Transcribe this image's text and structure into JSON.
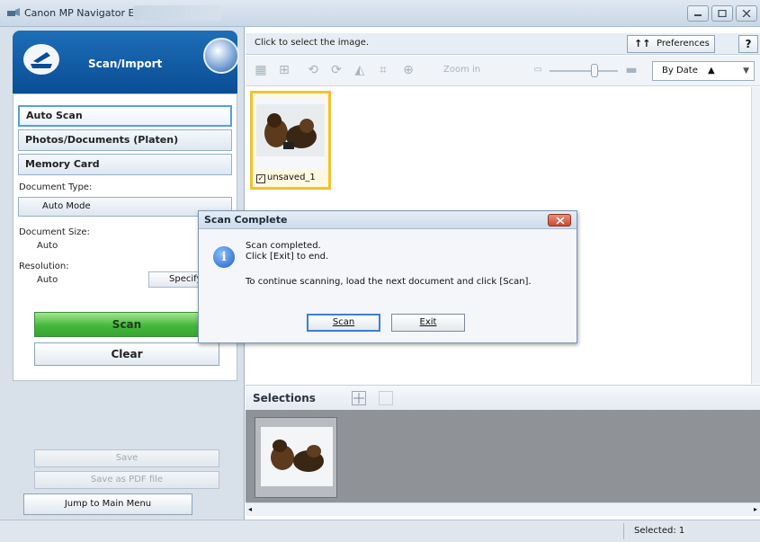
{
  "window": {
    "title": "Canon MP Navigator EX",
    "controls": [
      "minimize",
      "maximize",
      "close"
    ]
  },
  "left_panel": {
    "section_title": "Scan/Import",
    "modes": [
      {
        "label": "Auto Scan",
        "active": true
      },
      {
        "label": "Photos/Documents (Platen)",
        "active": false
      },
      {
        "label": "Memory Card",
        "active": false
      }
    ],
    "document_type_label": "Document Type:",
    "document_type_value": "Auto Mode",
    "document_size_label": "Document Size:",
    "document_size_value": "Auto",
    "resolution_label": "Resolution:",
    "resolution_value": "Auto",
    "specify_label": "Specify...",
    "scan_label": "Scan",
    "clear_label": "Clear",
    "save_label": "Save",
    "save_pdf_label": "Save as PDF file",
    "jump_label": "Jump to Main Menu"
  },
  "right_panel": {
    "hint": "Click to select the image.",
    "preferences_label": "Preferences",
    "help_label": "?",
    "zoom_label": "Zoom in",
    "sort_label": "By Date",
    "sort_direction": "ascending",
    "thumbnails": [
      {
        "label": "unsaved_1",
        "checked": true
      }
    ],
    "selections_title": "Selections",
    "selected_count_text": "Selected: 1"
  },
  "dialog": {
    "title": "Scan Complete",
    "icon": "info-icon",
    "line1": "Scan completed.",
    "line2": "Click [Exit] to end.",
    "line3": "To continue scanning, load the next document and click [Scan].",
    "scan_button": "Scan",
    "exit_button": "Exit"
  },
  "colors": {
    "header_blue": "#0a4d94",
    "scan_green": "#42b83a",
    "thumb_highlight": "#f1c232",
    "dialog_close_red": "#c84a30"
  }
}
